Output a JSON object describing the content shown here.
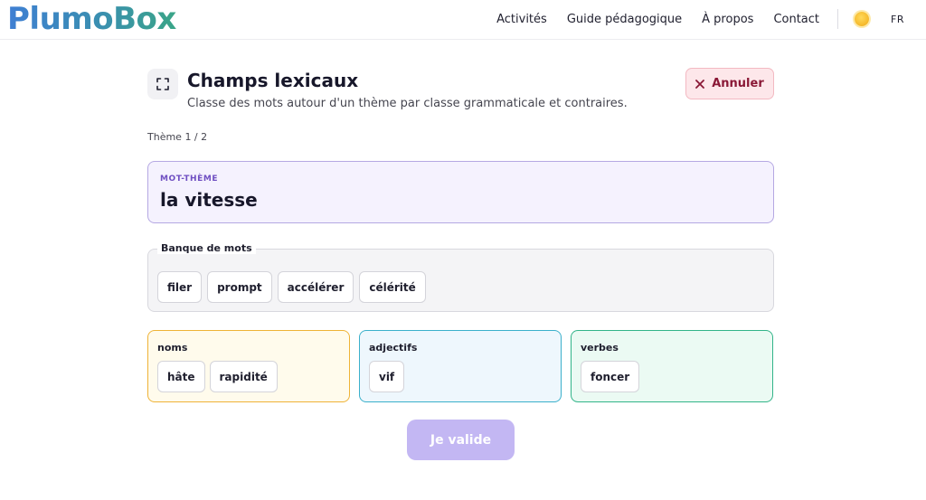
{
  "header": {
    "logo": "PlumoBox",
    "nav": [
      "Activités",
      "Guide pédagogique",
      "À propos",
      "Contact"
    ],
    "theme_icon": "sun-icon",
    "language": "FR"
  },
  "exercise": {
    "title": "Champs lexicaux",
    "subtitle": "Classe des mots autour d'un thème par classe grammaticale et contraires.",
    "cancel_label": "Annuler",
    "progress": "Thème 1 / 2",
    "theme_label": "MOT-THÈME",
    "theme_word": "la vitesse",
    "bank_label": "Banque de mots",
    "bank_words": [
      "filer",
      "prompt",
      "accélérer",
      "célérité"
    ],
    "categories": [
      {
        "name": "noms",
        "words": [
          "hâte",
          "rapidité"
        ]
      },
      {
        "name": "adjectifs",
        "words": [
          "vif"
        ]
      },
      {
        "name": "verbes",
        "words": [
          "foncer"
        ]
      }
    ],
    "submit_label": "Je valide"
  },
  "colors": {
    "accent": "#6f4fc2",
    "noms_border": "#efb337",
    "adjectifs_border": "#3bb0cb",
    "verbes_border": "#32b489",
    "cancel_text": "#8a1836",
    "submit_bg": "#c3b7f3"
  }
}
